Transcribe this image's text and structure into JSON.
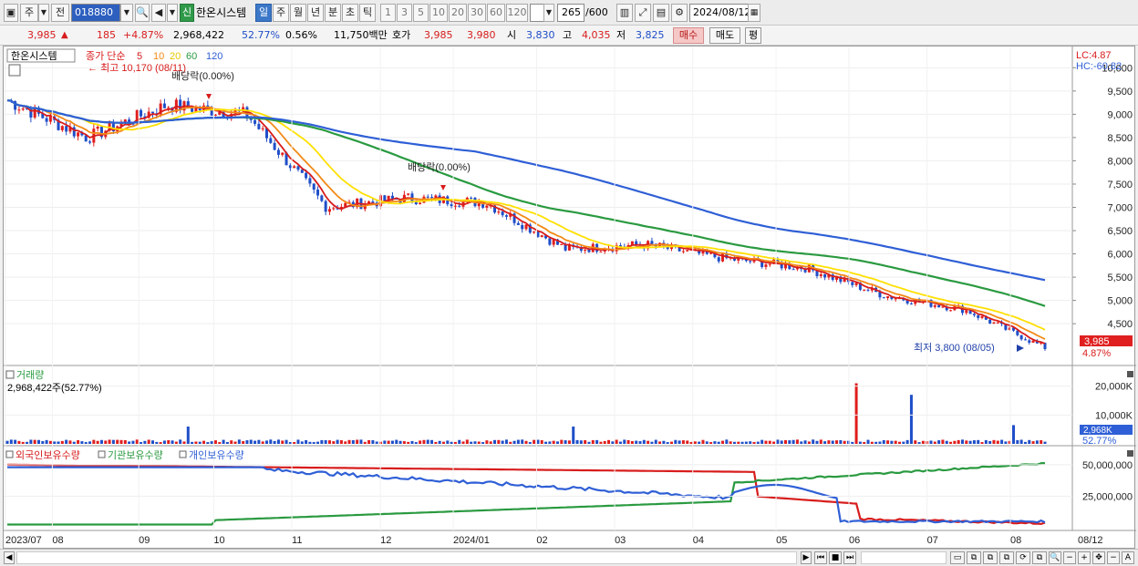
{
  "toolbar": {
    "market_label": "주",
    "prev_label": "전",
    "code_value": "018880",
    "sin_label": "신",
    "stock_name": "한온시스템",
    "periods": [
      "일",
      "주",
      "월",
      "년",
      "분",
      "초",
      "틱"
    ],
    "active_period": "일",
    "intervals": [
      "1",
      "3",
      "5",
      "10",
      "20",
      "30",
      "60",
      "120"
    ],
    "count_value": "265",
    "count_total": "/600",
    "date_value": "2024/08/12"
  },
  "quote": {
    "price": "3,985",
    "arrow": "▲",
    "change": "185",
    "change_pct": "+4.87%",
    "volume": "2,968,422",
    "vol_ratio": "52.77%",
    "turnover": "0.56%",
    "amount": "11,750백만",
    "ask_label": "호가",
    "ask": "3,985",
    "bid": "3,980",
    "open_label": "시",
    "open": "3,830",
    "high_label": "고",
    "high": "4,035",
    "low_label": "저",
    "low": "3,825",
    "buy_label": "매수",
    "sell_label": "매도",
    "eval_label": "평"
  },
  "price_panel": {
    "name": "한온시스템",
    "legend_prefix": "종가 단순",
    "ma_labels": [
      "5",
      "10",
      "20",
      "60",
      "120"
    ],
    "ma_colors": [
      "#d81c1c",
      "#f28a17",
      "#ffe000",
      "#2a9a40",
      "#2f5fd6"
    ],
    "lc_label": "LC:4.87",
    "hc_label": "HC:-60.82",
    "max_note": "최고 10,170 (08/11)",
    "min_note": "최저 3,800 (08/05)",
    "dividend_note_1": "배당락(0.00%)",
    "dividend_note_2": "배당락(0.00%)",
    "last_price_tag": "3,985",
    "last_pct_tag": "4.87%",
    "y_ticks": [
      "10,000",
      "9,500",
      "9,000",
      "8,500",
      "8,000",
      "7,500",
      "7,000",
      "6,500",
      "6,000",
      "5,500",
      "5,000",
      "4,500"
    ]
  },
  "volume_panel": {
    "title": "거래량",
    "value": "2,968,422주(52.77%)",
    "y_ticks": [
      "20,000K",
      "10,000K"
    ],
    "last_tag": "2,968K",
    "last_pct": "52.77%"
  },
  "holding_panel": {
    "legend": [
      "외국인보유수량",
      "기관보유수량",
      "개인보유수량"
    ],
    "colors": [
      "#d81c1c",
      "#2a9a40",
      "#2f5fd6"
    ],
    "y_ticks": [
      "50,000,000",
      "25,000,000"
    ]
  },
  "x_axis": {
    "labels": [
      "2023/07",
      "08",
      "09",
      "10",
      "11",
      "12",
      "2024/01",
      "02",
      "03",
      "04",
      "05",
      "06",
      "07",
      "08",
      "08/12"
    ]
  },
  "chart_data": {
    "type": "line",
    "ylim": [
      3800,
      10170
    ],
    "x": [
      "2023/07",
      "2023/08",
      "2023/09",
      "2023/10",
      "2023/11",
      "2023/12",
      "2024/01",
      "2024/02",
      "2024/03",
      "2024/04",
      "2024/05",
      "2024/06",
      "2024/07",
      "2024/08/12"
    ],
    "series": [
      {
        "name": "종가",
        "values": [
          9300,
          8500,
          9200,
          9000,
          7000,
          7200,
          7100,
          6100,
          6200,
          5900,
          5700,
          5100,
          4800,
          3985
        ]
      },
      {
        "name": "120",
        "values": [
          9200,
          9150,
          9050,
          8950,
          8650,
          8300,
          8000,
          7600,
          7200,
          6800,
          6300,
          6000,
          5700,
          5250
        ]
      },
      {
        "name": "60",
        "values": [
          9400,
          9200,
          9150,
          9100,
          8100,
          7800,
          7300,
          6900,
          6600,
          6300,
          5900,
          5500,
          5200,
          4700
        ]
      }
    ]
  }
}
